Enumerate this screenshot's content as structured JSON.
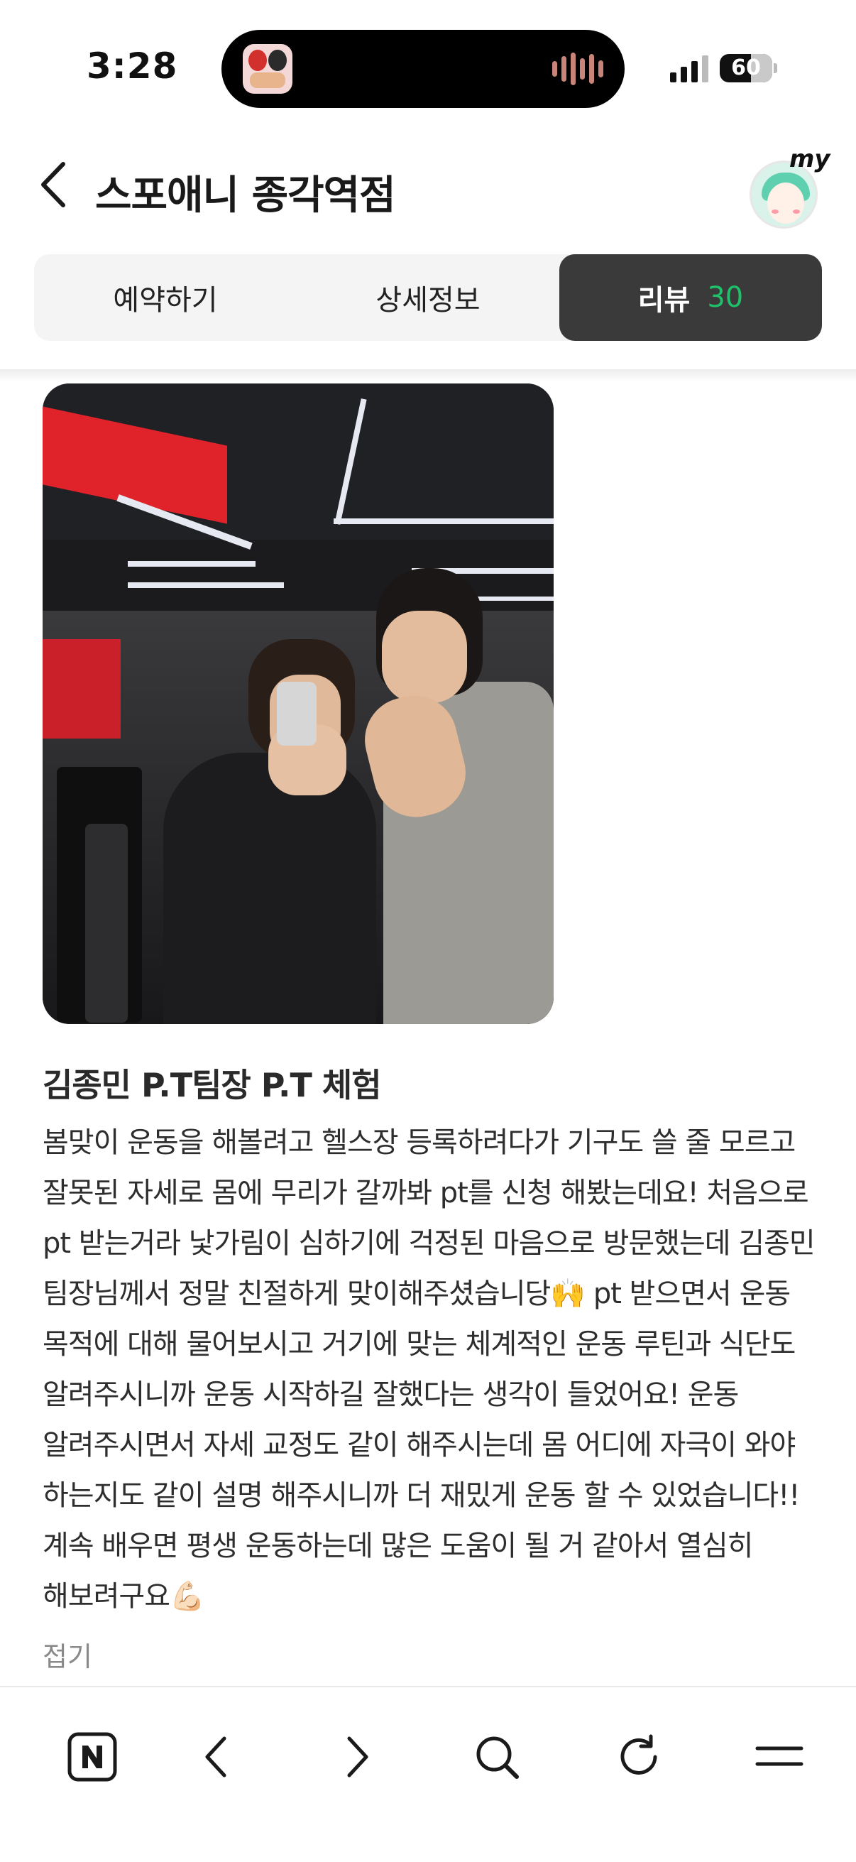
{
  "status_bar": {
    "time": "3:28",
    "battery": "60"
  },
  "header": {
    "title": "스포애니 종각역점",
    "my_label": "my"
  },
  "tabs": [
    {
      "label": "예약하기",
      "active": false
    },
    {
      "label": "상세정보",
      "active": false
    },
    {
      "label": "리뷰",
      "count": "30",
      "active": true
    }
  ],
  "review": {
    "title": "김종민 P.T팀장 P.T 체험",
    "body": "봄맞이 운동을 해볼려고 헬스장 등록하려다가 기구도 쓸 줄 모르고 잘못된 자세로 몸에 무리가 갈까봐 pt를 신청 해봤는데요! 처음으로 pt 받는거라 낯가림이 심하기에 걱정된 마음으로 방문했는데 김종민 팀장님께서 정말 친절하게 맞이해주셨습니당🙌 pt 받으면서 운동 목적에 대해 물어보시고 거기에 맞는 체계적인 운동 루틴과 식단도 알려주시니까 운동 시작하길 잘했다는 생각이 들었어요! 운동 알려주시면서 자세 교정도 같이 해주시는데 몸 어디에 자극이 와야 하는지도 같이 설명 해주시니까 더 재밌게 운동 할 수 있었습니다!! 계속 배우면 평생 운동하는데 많은 도움이 될 거 같아서 열심히 해보려구요💪🏻",
    "collapse_label": "접기"
  },
  "bottom_nav": [
    {
      "icon": "naver-n-icon"
    },
    {
      "icon": "back-arrow-icon"
    },
    {
      "icon": "forward-arrow-icon"
    },
    {
      "icon": "search-icon"
    },
    {
      "icon": "refresh-icon"
    },
    {
      "icon": "menu-icon"
    }
  ],
  "colors": {
    "active_tab_bg": "#3a3a3a",
    "review_count": "#1fc26a",
    "muted_text": "#8a8a8a"
  }
}
